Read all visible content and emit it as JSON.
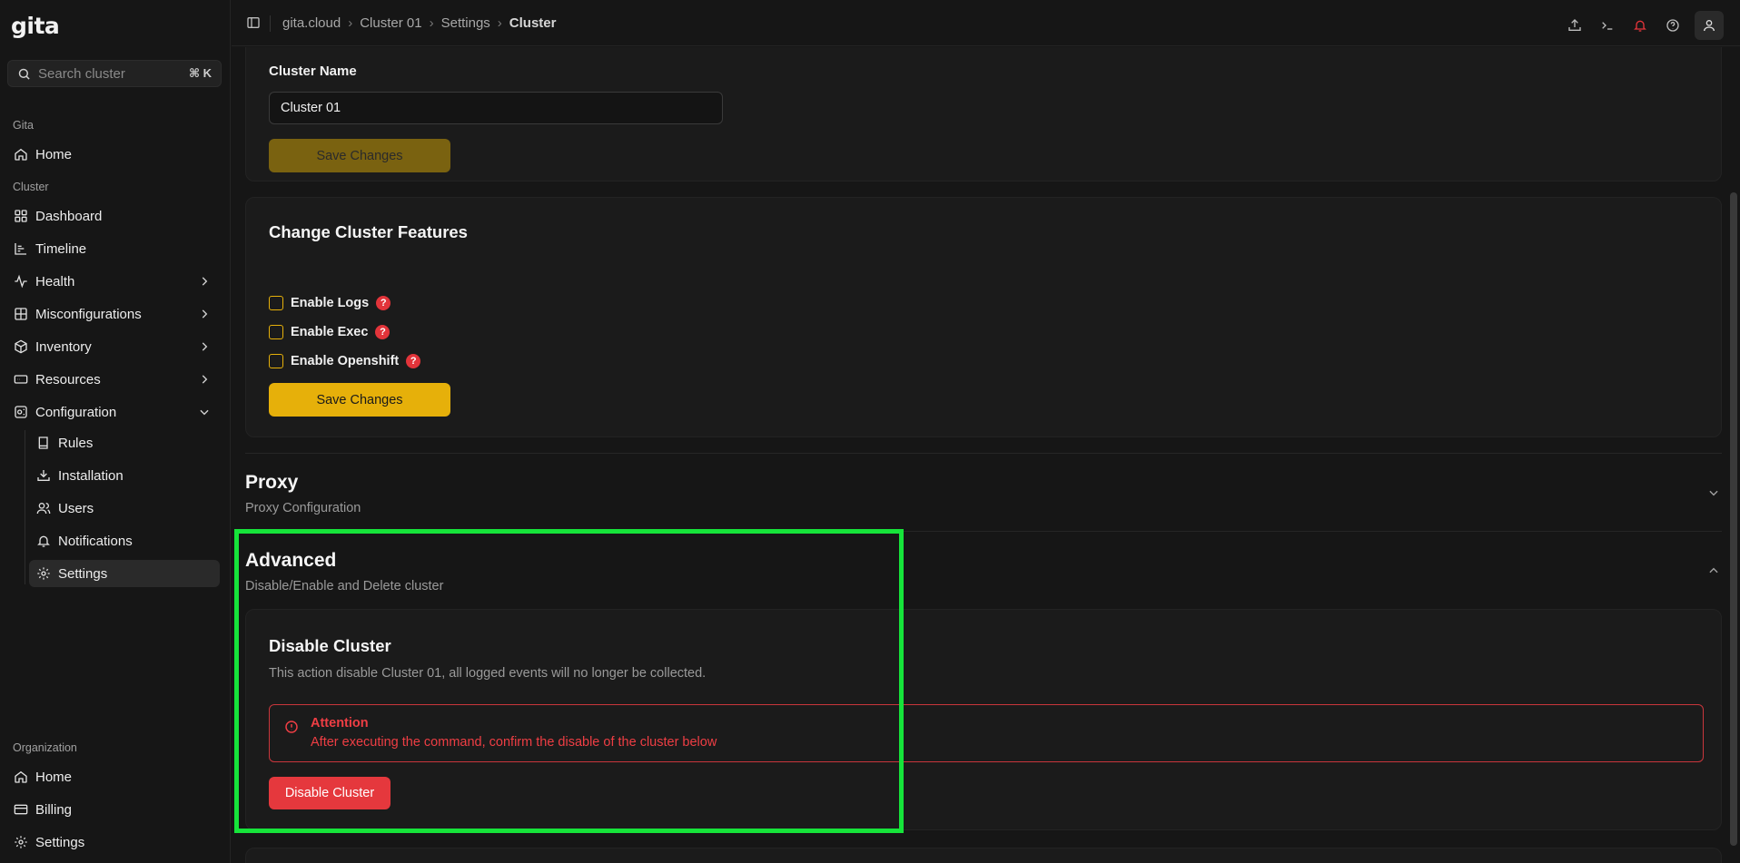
{
  "app": {
    "logo": "gita",
    "search_placeholder": "Search cluster",
    "search_shortcut": "⌘ K"
  },
  "sidebar": {
    "gita_label": "Gita",
    "gita_items": [
      {
        "label": "Home",
        "icon": "home-icon"
      }
    ],
    "cluster_label": "Cluster",
    "cluster_items": [
      {
        "label": "Dashboard",
        "icon": "dashboard-icon"
      },
      {
        "label": "Timeline",
        "icon": "timeline-icon"
      },
      {
        "label": "Health",
        "icon": "health-icon",
        "has_children": true
      },
      {
        "label": "Misconfigurations",
        "icon": "misconfigurations-icon",
        "has_children": true
      },
      {
        "label": "Inventory",
        "icon": "inventory-icon",
        "has_children": true
      },
      {
        "label": "Resources",
        "icon": "resources-icon",
        "has_children": true
      },
      {
        "label": "Configuration",
        "icon": "configuration-icon",
        "expanded": true
      }
    ],
    "configuration_items": [
      {
        "label": "Rules",
        "icon": "book-icon"
      },
      {
        "label": "Installation",
        "icon": "download-icon"
      },
      {
        "label": "Users",
        "icon": "users-icon"
      },
      {
        "label": "Notifications",
        "icon": "bell-icon"
      },
      {
        "label": "Settings",
        "icon": "gear-icon",
        "active": true
      }
    ],
    "org_label": "Organization",
    "org_items": [
      {
        "label": "Home",
        "icon": "home-icon"
      },
      {
        "label": "Billing",
        "icon": "billing-icon"
      },
      {
        "label": "Settings",
        "icon": "gear-icon"
      }
    ]
  },
  "breadcrumb": [
    "gita.cloud",
    "Cluster 01",
    "Settings",
    "Cluster"
  ],
  "cluster_name_card": {
    "label": "Cluster Name",
    "value": "Cluster 01",
    "save_label": "Save Changes"
  },
  "features_card": {
    "title": "Change Cluster Features",
    "features": [
      {
        "label": "Enable Logs",
        "checked": false
      },
      {
        "label": "Enable Exec",
        "checked": false
      },
      {
        "label": "Enable Openshift",
        "checked": false
      }
    ],
    "save_label": "Save Changes",
    "help_glyph": "?"
  },
  "proxy": {
    "title": "Proxy",
    "subtitle": "Proxy Configuration"
  },
  "advanced": {
    "title": "Advanced",
    "subtitle": "Disable/Enable and Delete cluster",
    "disable_card": {
      "title": "Disable Cluster",
      "description": "This action disable Cluster 01, all logged events will no longer be collected.",
      "alert_title": "Attention",
      "alert_text": "After executing the command, confirm the disable of the cluster below",
      "button_label": "Disable Cluster"
    }
  },
  "colors": {
    "accent": "#e6b00a",
    "danger": "#e5383d",
    "highlight": "#16e43a",
    "notification": "#e2343a"
  }
}
